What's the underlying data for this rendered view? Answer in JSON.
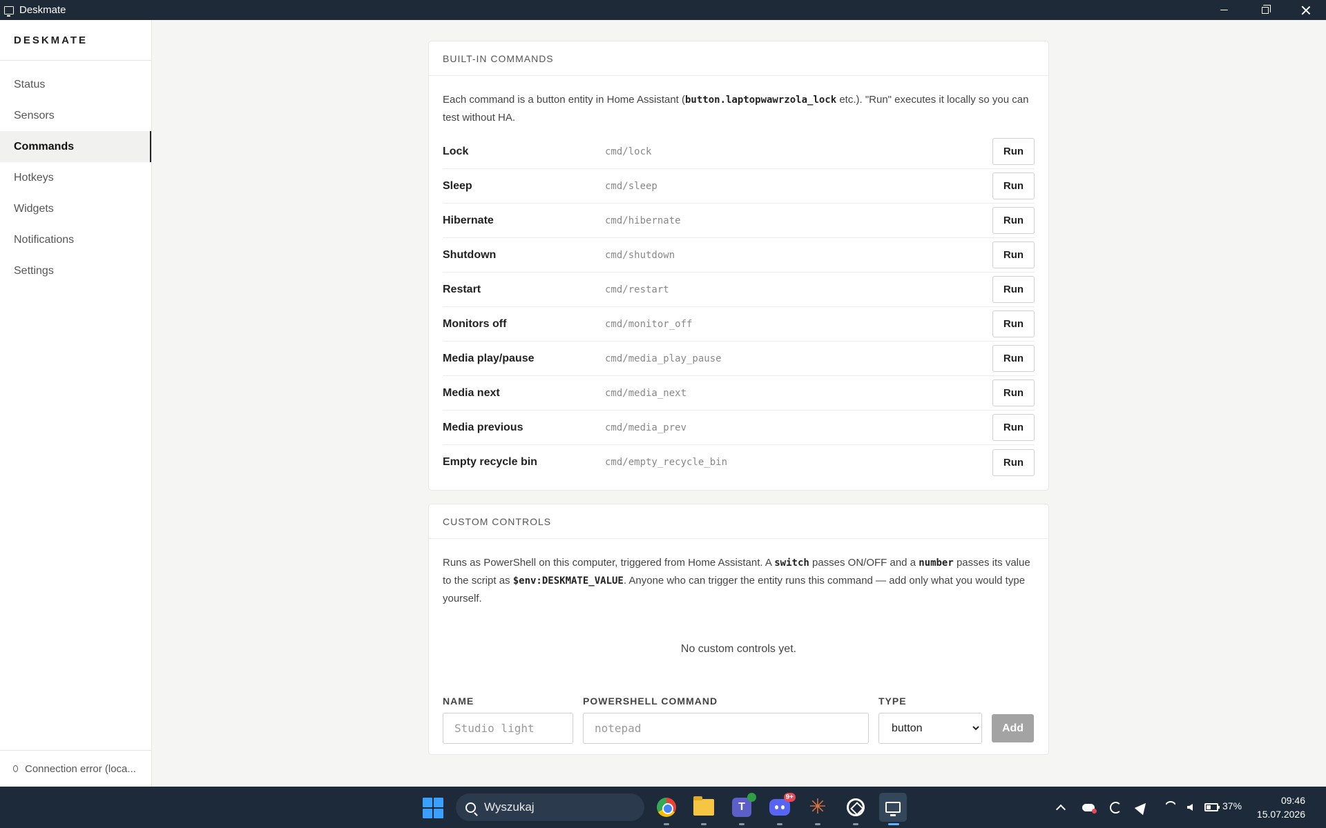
{
  "window": {
    "title": "Deskmate"
  },
  "sidebar": {
    "brand": "DESKMATE",
    "items": [
      {
        "label": "Status",
        "active": false
      },
      {
        "label": "Sensors",
        "active": false
      },
      {
        "label": "Commands",
        "active": true
      },
      {
        "label": "Hotkeys",
        "active": false
      },
      {
        "label": "Widgets",
        "active": false
      },
      {
        "label": "Notifications",
        "active": false
      },
      {
        "label": "Settings",
        "active": false
      }
    ],
    "connection_status": "Connection error (loca..."
  },
  "builtin": {
    "title": "BUILT-IN COMMANDS",
    "desc_1": "Each command is a button entity in Home Assistant (",
    "desc_code": "button.laptopwawrzola_lock",
    "desc_2": " etc.). \"Run\" executes it locally so you can test without HA.",
    "run_label": "Run",
    "commands": [
      {
        "name": "Lock",
        "topic": "cmd/lock"
      },
      {
        "name": "Sleep",
        "topic": "cmd/sleep"
      },
      {
        "name": "Hibernate",
        "topic": "cmd/hibernate"
      },
      {
        "name": "Shutdown",
        "topic": "cmd/shutdown"
      },
      {
        "name": "Restart",
        "topic": "cmd/restart"
      },
      {
        "name": "Monitors off",
        "topic": "cmd/monitor_off"
      },
      {
        "name": "Media play/pause",
        "topic": "cmd/media_play_pause"
      },
      {
        "name": "Media next",
        "topic": "cmd/media_next"
      },
      {
        "name": "Media previous",
        "topic": "cmd/media_prev"
      },
      {
        "name": "Empty recycle bin",
        "topic": "cmd/empty_recycle_bin"
      }
    ]
  },
  "custom": {
    "title": "CUSTOM CONTROLS",
    "desc_1": "Runs as PowerShell on this computer, triggered from Home Assistant. A ",
    "desc_code_1": "switch",
    "desc_2": " passes ON/OFF and a ",
    "desc_code_2": "number",
    "desc_3": " passes its value to the script as ",
    "desc_code_3": "$env:DESKMATE_VALUE",
    "desc_4": ". Anyone who can trigger the entity runs this command — add only what you would type yourself.",
    "empty_text": "No custom controls yet.",
    "name_label": "NAME",
    "name_placeholder": "Studio light",
    "command_label": "POWERSHELL COMMAND",
    "command_placeholder": "notepad",
    "type_label": "TYPE",
    "type_selected": "button",
    "add_label": "Add"
  },
  "taskbar": {
    "search_label": "Wyszukaj",
    "discord_badge": "9+",
    "battery": "37%",
    "time": "09:46",
    "date": "15.07.2026"
  }
}
